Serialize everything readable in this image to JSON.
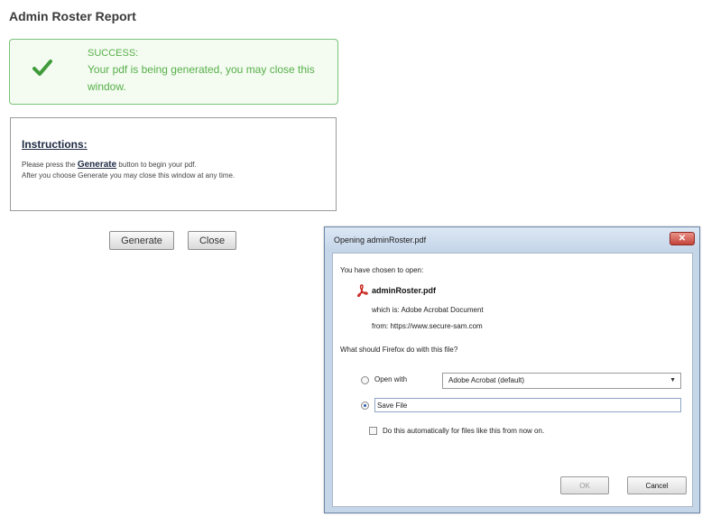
{
  "page": {
    "title": "Admin Roster Report"
  },
  "success": {
    "title": "SUCCESS:",
    "message": "Your pdf is being generated, you may close this window.",
    "icon": "checkmark-icon",
    "color": "#57b04a"
  },
  "instructions": {
    "title": "Instructions:",
    "line1_prefix": "Please press the",
    "line1_link": "Generate",
    "line1_suffix": "button to begin your pdf.",
    "line2": "After you choose Generate you may close this window at any time."
  },
  "buttons": {
    "generate": "Generate",
    "close": "Close"
  },
  "dialog": {
    "title": "Opening adminRoster.pdf",
    "close_icon": "close-icon",
    "chosen_text": "You have chosen to open:",
    "filename": "adminRoster.pdf",
    "file_icon": "pdf-file-icon",
    "which_is_label": "which is:",
    "which_is_value": "Adobe Acrobat Document",
    "from_label": "from:",
    "from_value": "https://www.secure-sam.com",
    "question": "What should Firefox do with this file?",
    "open_with_label": "Open with",
    "open_with_app": "Adobe Acrobat  (default)",
    "save_file_label": "Save File",
    "selected_option": "Save File",
    "auto_label": "Do this automatically for files like this from now on.",
    "auto_checked": false,
    "ok_label": "OK",
    "ok_enabled": false,
    "cancel_label": "Cancel"
  }
}
